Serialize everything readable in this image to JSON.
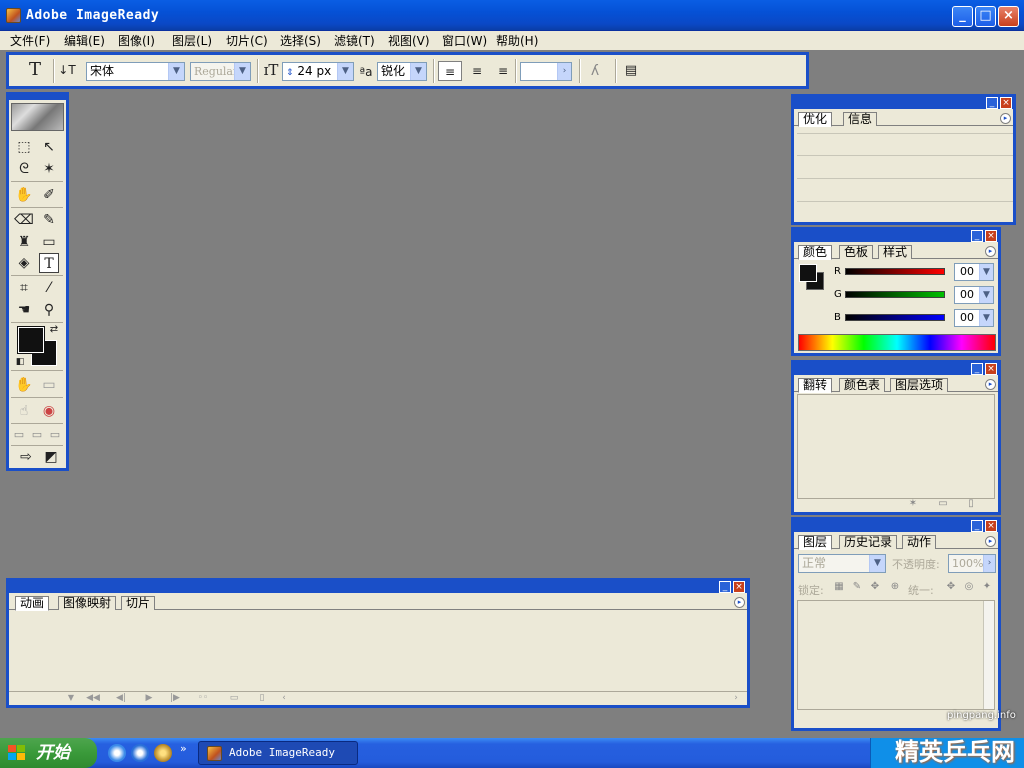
{
  "window": {
    "title": "Adobe ImageReady",
    "min": "_",
    "max": "□",
    "close": "×"
  },
  "menu": [
    "文件(F)",
    "编辑(E)",
    "图像(I)",
    "图层(L)",
    "切片(C)",
    "选择(S)",
    "滤镜(T)",
    "视图(V)",
    "窗口(W)",
    "帮助(H)"
  ],
  "options": {
    "font_family": "宋体",
    "font_style": "Regular",
    "font_size": "24 px",
    "antialias": "锐化",
    "color_field": ""
  },
  "panel_optimize": {
    "tabs": [
      "优化",
      "信息"
    ]
  },
  "panel_color": {
    "tabs": [
      "颜色",
      "色板",
      "样式"
    ],
    "channels": [
      {
        "label": "R",
        "value": "00"
      },
      {
        "label": "G",
        "value": "00"
      },
      {
        "label": "B",
        "value": "00"
      }
    ]
  },
  "panel_rollover": {
    "tabs": [
      "翻转",
      "颜色表",
      "图层选项"
    ]
  },
  "panel_layers": {
    "tabs": [
      "图层",
      "历史记录",
      "动作"
    ],
    "blend_mode": "正常",
    "opacity_label": "不透明度:",
    "opacity_value": "100%",
    "lock_label": "锁定:",
    "unify_label": "统一:"
  },
  "panel_animation": {
    "tabs": [
      "动画",
      "图像映射",
      "切片"
    ]
  },
  "taskbar": {
    "start": "开始",
    "task_label": "Adobe ImageReady"
  },
  "watermark": {
    "url": "pingpang.info",
    "text": "精英乒乓网"
  },
  "colors": {
    "title_blue": "#0a5ee4",
    "panel_border": "#1a4fc8",
    "workspace": "#7f7f7f",
    "panel_bg": "#ece9d8"
  }
}
